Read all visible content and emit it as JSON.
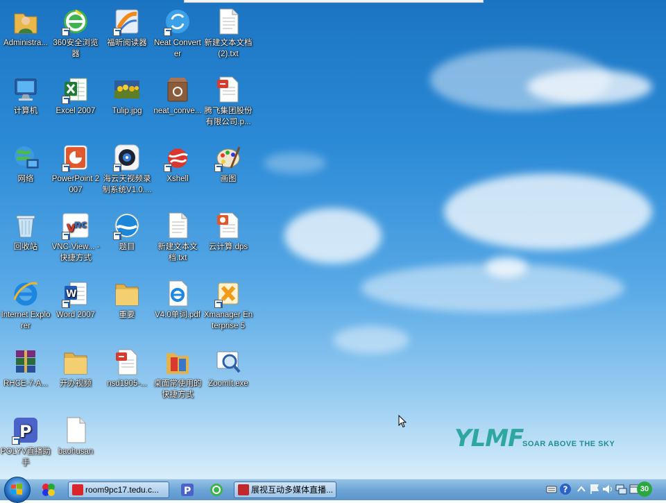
{
  "desktop": {
    "icons": [
      {
        "label": "Administra...",
        "icon": "user-folder-icon",
        "shortcut": false
      },
      {
        "label": "360安全浏览器",
        "icon": "360-browser-icon",
        "shortcut": true
      },
      {
        "label": "福昕阅读器",
        "icon": "foxit-reader-icon",
        "shortcut": true
      },
      {
        "label": "Neat Converter",
        "icon": "neat-converter-icon",
        "shortcut": true
      },
      {
        "label": "新建文本文档 (2).txt",
        "icon": "text-file-icon",
        "shortcut": false
      },
      {
        "label": "计算机",
        "icon": "computer-icon",
        "shortcut": false
      },
      {
        "label": "Excel 2007",
        "icon": "excel-icon",
        "shortcut": true
      },
      {
        "label": "Tulip.jpg",
        "icon": "image-file-icon",
        "shortcut": false
      },
      {
        "label": "neat_conve...",
        "icon": "archive-box-icon",
        "shortcut": false
      },
      {
        "label": "腾飞集团股份有限公司.p...",
        "icon": "pdf-file-icon",
        "shortcut": false
      },
      {
        "label": "网络",
        "icon": "network-icon",
        "shortcut": false
      },
      {
        "label": "PowerPoint 2007",
        "icon": "powerpoint-icon",
        "shortcut": true
      },
      {
        "label": "海云天视频录制系统V1.0....",
        "icon": "video-recorder-icon",
        "shortcut": true
      },
      {
        "label": "Xshell",
        "icon": "xshell-icon",
        "shortcut": true
      },
      {
        "label": "画图",
        "icon": "paint-icon",
        "shortcut": true
      },
      {
        "label": "回收站",
        "icon": "recycle-bin-icon",
        "shortcut": false
      },
      {
        "label": "VNC-View... - 快捷方式",
        "icon": "vnc-viewer-icon",
        "shortcut": true
      },
      {
        "label": "题目",
        "icon": "globe-app-icon",
        "shortcut": true
      },
      {
        "label": "新建文本文档.txt",
        "icon": "text-file-icon",
        "shortcut": false
      },
      {
        "label": "云计算.dps",
        "icon": "presentation-file-icon",
        "shortcut": false
      },
      {
        "label": "Internet Explorer",
        "icon": "internet-explorer-icon",
        "shortcut": false
      },
      {
        "label": "Word 2007",
        "icon": "word-icon",
        "shortcut": true
      },
      {
        "label": "重要",
        "icon": "folder-icon",
        "shortcut": false
      },
      {
        "label": "V4.0单词.pdf",
        "icon": "ie-document-icon",
        "shortcut": false
      },
      {
        "label": "Xmanager Enterprise 5",
        "icon": "xmanager-icon",
        "shortcut": true
      },
      {
        "label": "RHCE-7-A...",
        "icon": "winrar-archive-icon",
        "shortcut": false
      },
      {
        "label": "开办视频",
        "icon": "folder-icon",
        "shortcut": false
      },
      {
        "label": "nsd1905-...",
        "icon": "pdf-file-icon",
        "shortcut": false
      },
      {
        "label": "桌面常使用的快捷方式",
        "icon": "shortcut-folder-icon",
        "shortcut": false
      },
      {
        "label": "ZoomIt.exe",
        "icon": "zoomit-icon",
        "shortcut": false
      },
      {
        "label": "POLYV直播助手",
        "icon": "polyv-icon",
        "shortcut": true
      },
      {
        "label": "baohusan",
        "icon": "blank-file-icon",
        "shortcut": false
      }
    ]
  },
  "wallpaper": {
    "logo": "YLMF",
    "tagline": "SOAR ABOVE THE SKY"
  },
  "taskbar": {
    "quick_launch": [
      {
        "icon": "quick-launch-app-icon"
      },
      {
        "icon": "polyv-quick-icon"
      },
      {
        "icon": "360-browser-quick-icon"
      }
    ],
    "buttons": [
      {
        "label": "room9pc17.tedu.c...",
        "icon": "vnc-task-icon",
        "color": "#d8262b"
      },
      {
        "label": "展视互动多媒体直播...",
        "icon": "live-stream-task-icon",
        "color": "#c0282a"
      }
    ],
    "tray": [
      {
        "icon": "tray-keyboard-icon"
      },
      {
        "icon": "help-icon"
      },
      {
        "icon": "tray-expand-icon"
      },
      {
        "icon": "tray-flag-icon"
      },
      {
        "icon": "volume-icon"
      },
      {
        "icon": "network-tray-icon"
      },
      {
        "icon": "show-desktop-icon"
      }
    ],
    "clock_badge": "30"
  }
}
